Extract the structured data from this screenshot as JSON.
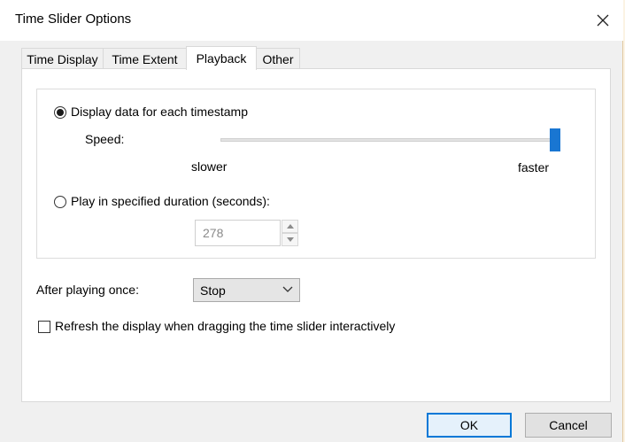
{
  "window": {
    "title": "Time Slider Options"
  },
  "tabs": [
    {
      "label": "Time Display"
    },
    {
      "label": "Time Extent"
    },
    {
      "label": "Playback"
    },
    {
      "label": "Other"
    }
  ],
  "playback": {
    "radio_each_timestamp": {
      "label": "Display data for each timestamp",
      "checked": true
    },
    "speed": {
      "label": "Speed:",
      "min_label": "slower",
      "max_label": "faster",
      "value_fraction": 1.0
    },
    "radio_duration": {
      "label": "Play in specified duration (seconds):",
      "checked": false
    },
    "duration_value": "278",
    "after_playing": {
      "label": "After playing once:",
      "selected": "Stop"
    },
    "refresh": {
      "label": "Refresh the display when dragging the time slider interactively",
      "checked": false
    }
  },
  "buttons": {
    "ok": "OK",
    "cancel": "Cancel"
  },
  "colors": {
    "accent": "#0078d7",
    "slider_thumb": "#1976d2"
  }
}
